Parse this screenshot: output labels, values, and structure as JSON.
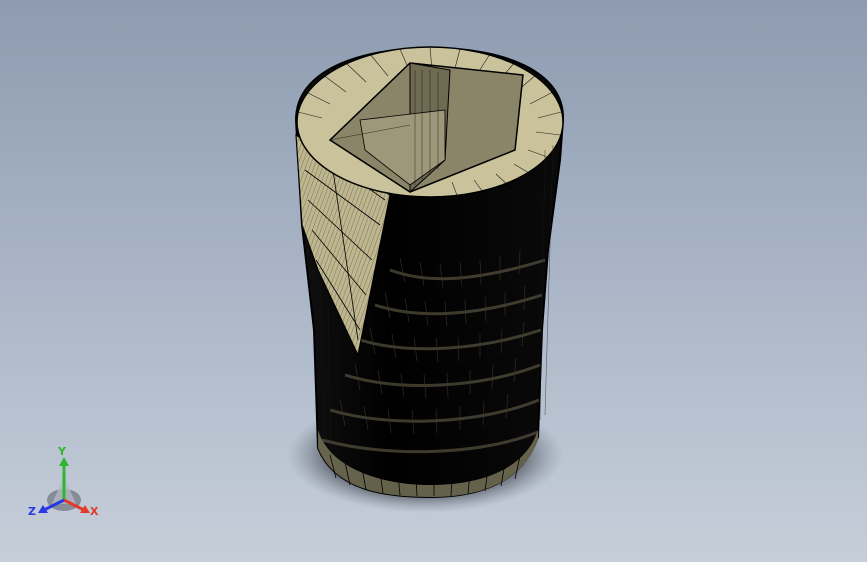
{
  "viewport": {
    "background_top": "#8e9bb0",
    "background_bottom": "#c6ced9"
  },
  "model": {
    "icon": "threaded-plug-with-square-socket",
    "surface_color": "#c9c29a",
    "mesh_color": "#000000"
  },
  "triad": {
    "x_label": "X",
    "y_label": "Y",
    "z_label": "Z",
    "x_color": "#e23a2a",
    "y_color": "#2fb52f",
    "z_color": "#2a3ae2"
  }
}
